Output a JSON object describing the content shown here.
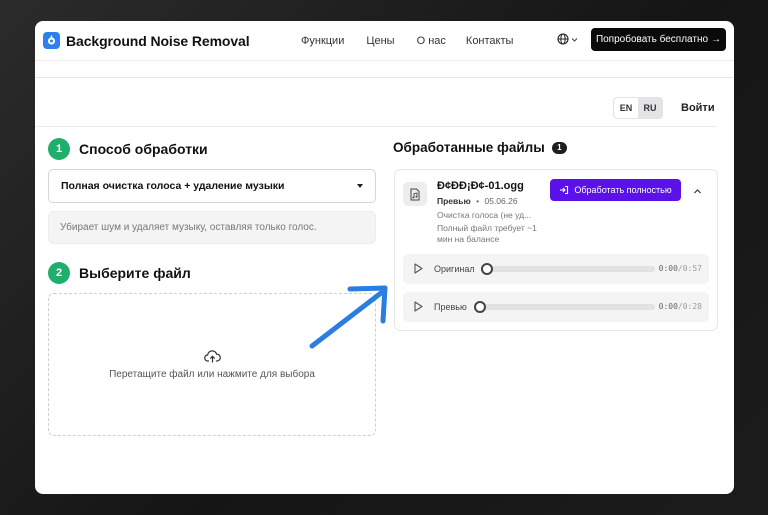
{
  "app": {
    "name": "Background Noise Removal"
  },
  "nav": {
    "items": [
      "Функции",
      "Цены",
      "О нас",
      "Контакты"
    ],
    "cta_label": "Попробовать бесплатно",
    "cta_arrow": "→"
  },
  "lang": {
    "options": [
      "EN",
      "RU"
    ],
    "selected": "RU"
  },
  "login_label": "Войти",
  "step1": {
    "number": "1",
    "title": "Способ обработки",
    "selected_option": "Полная очистка голоса + удаление музыки",
    "description": "Убирает шум и удаляет музыку, оставляя только голос."
  },
  "step2": {
    "number": "2",
    "title": "Выберите файл",
    "drop_text": "Перетащите файл или нажмите для выбора"
  },
  "files": {
    "title": "Обработанные файлы",
    "count": "1",
    "items": [
      {
        "name": "Ð¢ÐÐ¡Ð¢-01.ogg",
        "status": "Превью",
        "separator": "•",
        "date": "05.06.26",
        "mode": "Очистка голоса (не уд...",
        "note": "Полный файл требует ~1 мин на балансе",
        "process_label": "Обработать полностью",
        "players": [
          {
            "label": "Оригинал",
            "current": "0:00",
            "separator": "/",
            "duration": "0:57",
            "progress": 0
          },
          {
            "label": "Превью",
            "current": "0:00",
            "separator": "/",
            "duration": "0:28",
            "progress": 0
          }
        ]
      }
    ]
  },
  "colors": {
    "accent": "#5b12ea",
    "step_badge": "#1fae6b",
    "annotation_arrow": "#2a7de1",
    "logo": "#2f80ed"
  }
}
